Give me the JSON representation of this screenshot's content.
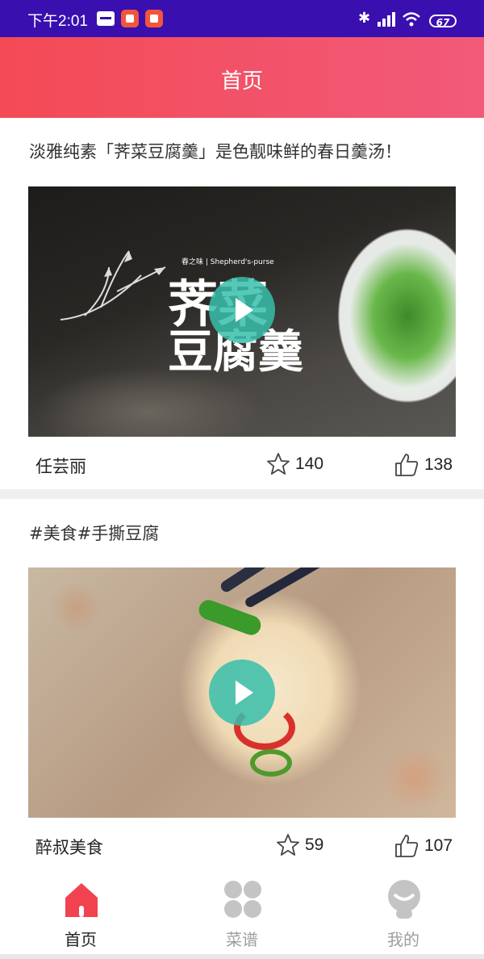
{
  "status_bar": {
    "time": "下午2:01",
    "battery": "67"
  },
  "header": {
    "title": "首页"
  },
  "posts": [
    {
      "title": "淡雅纯素「荠菜豆腐羹」是色靓味鲜的春日羹汤！",
      "overlay_text_1": "荠菜",
      "overlay_text_2": "豆腐羹",
      "overlay_small": "春之味 | Shepherd's-purse",
      "author": "任芸丽",
      "favorites": "140",
      "likes": "138"
    },
    {
      "title": "#美食#手撕豆腐",
      "author": "醉叔美食",
      "favorites": "59",
      "likes": "107"
    }
  ],
  "tabs": [
    {
      "label": "首页",
      "active": true,
      "color": "#f0434f"
    },
    {
      "label": "菜谱",
      "active": false,
      "color": "#bdbdbd"
    },
    {
      "label": "我的",
      "active": false,
      "color": "#bdbdbd"
    }
  ],
  "colors": {
    "header_start": "#f34a55",
    "header_end": "#f25a7a",
    "status_bar": "#3a0fb0",
    "play_button": "#37beaa"
  },
  "icons": [
    "message-icon",
    "app-notification-icon",
    "bluetooth-icon",
    "signal-icon",
    "wifi-icon",
    "battery-icon",
    "play-icon",
    "star-icon",
    "thumbs-up-icon",
    "home-icon",
    "recipes-icon",
    "profile-icon"
  ]
}
